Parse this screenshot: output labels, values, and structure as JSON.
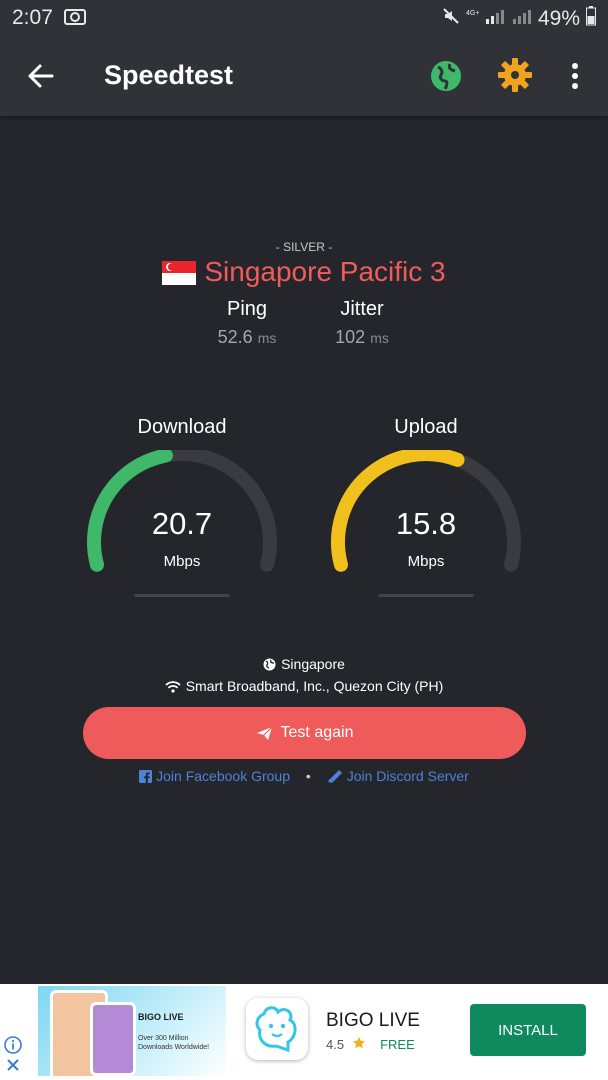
{
  "status_bar": {
    "time": "2:07",
    "battery": "49%"
  },
  "app_bar": {
    "title": "Speedtest"
  },
  "server": {
    "tier": "- SILVER -",
    "name": "Singapore Pacific 3"
  },
  "metrics": {
    "ping": {
      "label": "Ping",
      "value": "52.6",
      "unit": "ms"
    },
    "jitter": {
      "label": "Jitter",
      "value": "102",
      "unit": "ms"
    }
  },
  "download": {
    "title": "Download",
    "value": "20.7",
    "unit": "Mbps",
    "fraction": 0.45,
    "color": "#3fb86a"
  },
  "upload": {
    "title": "Upload",
    "value": "15.8",
    "unit": "Mbps",
    "fraction": 0.6,
    "color": "#f2c01c"
  },
  "location": {
    "city": "Singapore",
    "isp": "Smart Broadband, Inc., Quezon City (PH)"
  },
  "actions": {
    "test_again": "Test again",
    "facebook": "Join Facebook Group",
    "separator": "•",
    "discord": "Join Discord Server"
  },
  "ad": {
    "banner_brand": "BIGO LIVE",
    "banner_tagline": "Over 300 Million Downloads Worldwide!",
    "app_name": "BIGO LIVE",
    "rating": "4.5",
    "price": "FREE",
    "install": "INSTALL"
  },
  "colors": {
    "accent": "#ef5b5b",
    "link": "#4b83d8",
    "globe": "#3fb86a",
    "gear": "#f2a31c"
  }
}
